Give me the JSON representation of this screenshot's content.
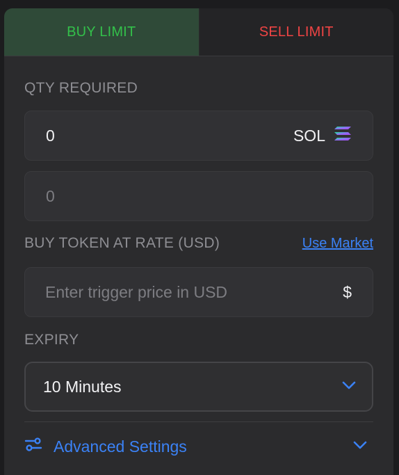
{
  "tabs": {
    "buy_label": "BUY LIMIT",
    "sell_label": "SELL LIMIT"
  },
  "qty": {
    "label": "QTY REQUIRED",
    "value": "0",
    "unit": "SOL",
    "second_value": "0"
  },
  "rate": {
    "label": "BUY TOKEN AT RATE (USD)",
    "use_market": "Use Market",
    "placeholder": "Enter trigger price in USD",
    "currency_symbol": "$"
  },
  "expiry": {
    "label": "EXPIRY",
    "selected": "10 Minutes"
  },
  "advanced": {
    "label": "Advanced Settings"
  },
  "colors": {
    "buy_green": "#33c04a",
    "sell_red": "#ef4444",
    "link_blue": "#3b82f6"
  },
  "icons": {
    "token": "solana-icon",
    "dropdown": "chevron-down-icon",
    "settings": "sliders-icon"
  }
}
